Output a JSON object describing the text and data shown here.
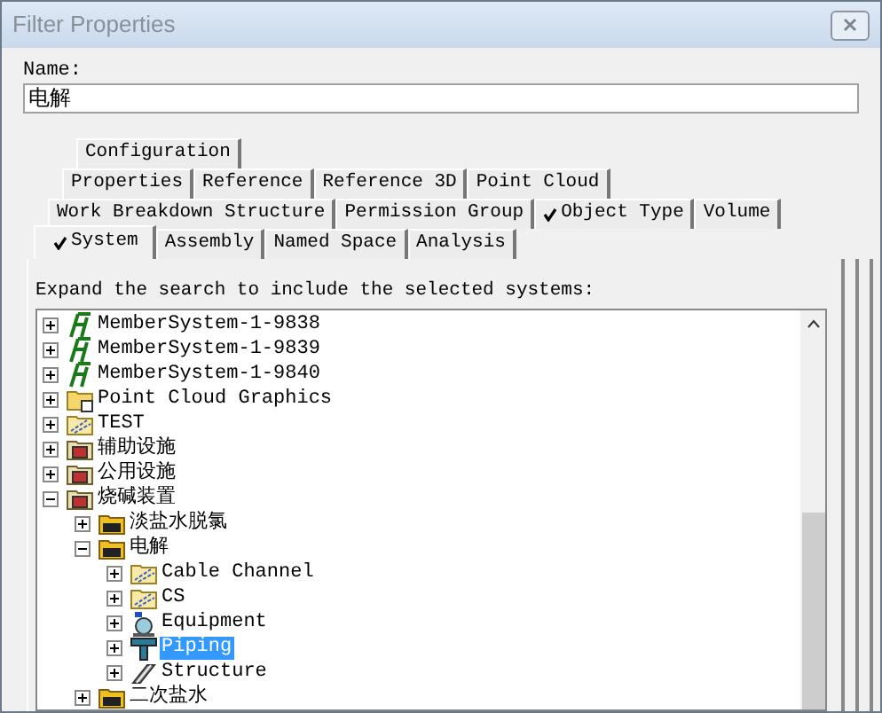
{
  "window": {
    "title": "Filter Properties"
  },
  "name_field": {
    "label": "Name:",
    "value": "电解"
  },
  "tab_rows": [
    [
      {
        "label": "Configuration",
        "checked": false,
        "selected": false
      }
    ],
    [
      {
        "label": "Properties",
        "checked": false,
        "selected": false
      },
      {
        "label": "Reference",
        "checked": false,
        "selected": false
      },
      {
        "label": "Reference 3D",
        "checked": false,
        "selected": false
      },
      {
        "label": "Point Cloud",
        "checked": false,
        "selected": false
      }
    ],
    [
      {
        "label": "Work Breakdown Structure",
        "checked": false,
        "selected": false
      },
      {
        "label": "Permission Group",
        "checked": false,
        "selected": false
      },
      {
        "label": "Object Type",
        "checked": true,
        "selected": false
      },
      {
        "label": "Volume",
        "checked": false,
        "selected": false
      }
    ],
    [
      {
        "label": "System",
        "checked": true,
        "selected": true
      },
      {
        "label": "Assembly",
        "checked": false,
        "selected": false
      },
      {
        "label": "Named Space",
        "checked": false,
        "selected": false
      },
      {
        "label": "Analysis",
        "checked": false,
        "selected": false
      }
    ]
  ],
  "instruction": "Expand the search to include the selected systems:",
  "tree": [
    {
      "label": "MemberSystem-1-9838",
      "kind": "member",
      "expanded": false,
      "selected": false
    },
    {
      "label": "MemberSystem-1-9839",
      "kind": "member",
      "expanded": false,
      "selected": false
    },
    {
      "label": "MemberSystem-1-9840",
      "kind": "member",
      "expanded": false,
      "selected": false
    },
    {
      "label": "Point Cloud Graphics",
      "kind": "folder",
      "expanded": false,
      "selected": false
    },
    {
      "label": "TEST",
      "kind": "system",
      "expanded": false,
      "selected": false
    },
    {
      "label": "辅助设施",
      "kind": "plant",
      "expanded": false,
      "selected": false
    },
    {
      "label": "公用设施",
      "kind": "plant",
      "expanded": false,
      "selected": false
    },
    {
      "label": "烧碱装置",
      "kind": "plant",
      "expanded": true,
      "selected": false,
      "children": [
        {
          "label": "淡盐水脱氯",
          "kind": "area",
          "expanded": false,
          "selected": false
        },
        {
          "label": "电解",
          "kind": "area",
          "expanded": true,
          "selected": false,
          "children": [
            {
              "label": "Cable Channel",
              "kind": "system",
              "expanded": false,
              "selected": false
            },
            {
              "label": "CS",
              "kind": "system",
              "expanded": false,
              "selected": false
            },
            {
              "label": "Equipment",
              "kind": "equipment",
              "expanded": false,
              "selected": false
            },
            {
              "label": "Piping",
              "kind": "piping",
              "expanded": false,
              "selected": true
            },
            {
              "label": "Structure",
              "kind": "structure",
              "expanded": false,
              "selected": false
            }
          ]
        },
        {
          "label": "二次盐水",
          "kind": "area",
          "expanded": false,
          "selected": false
        }
      ]
    }
  ]
}
